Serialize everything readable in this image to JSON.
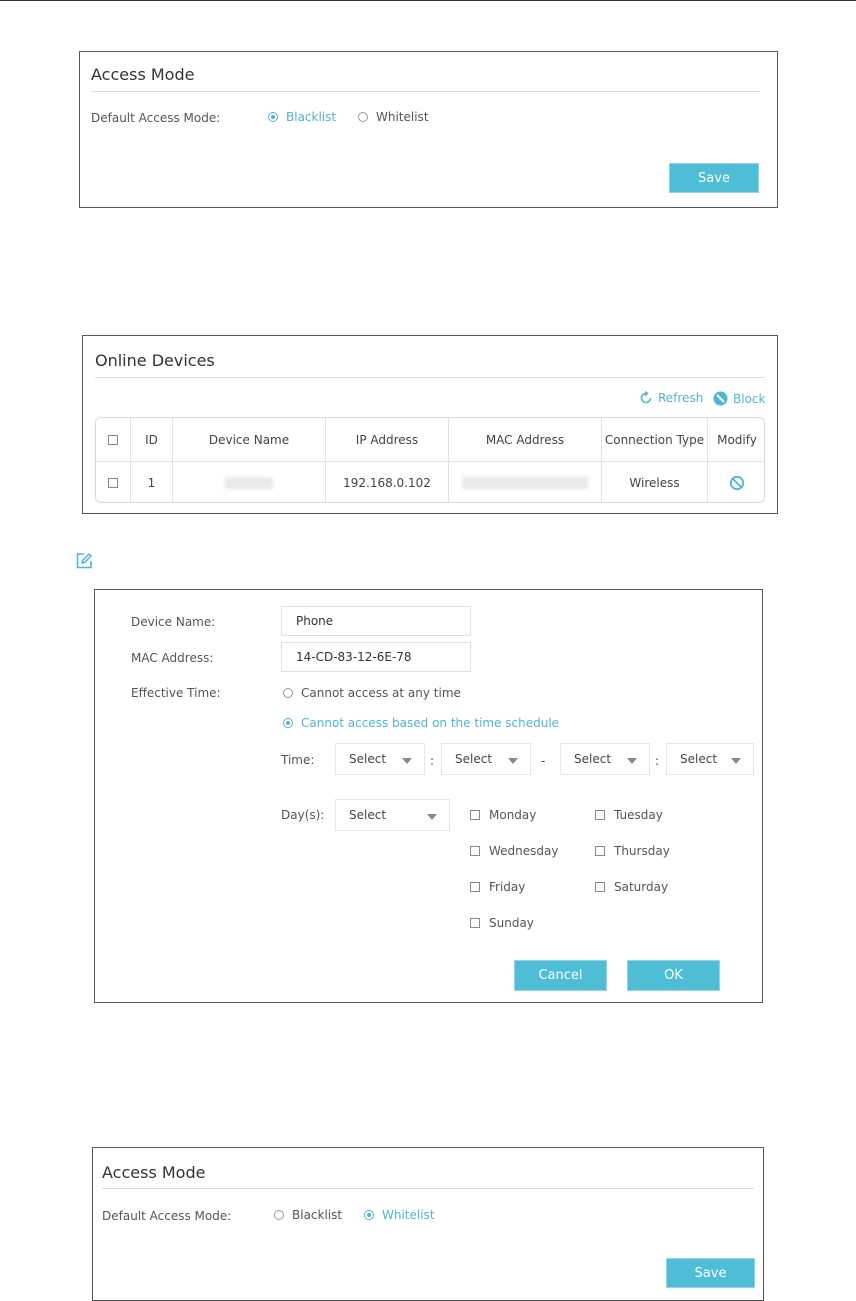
{
  "access_mode_top": {
    "title": "Access Mode",
    "default_label": "Default Access Mode:",
    "options": [
      {
        "label": "Blacklist",
        "selected": true
      },
      {
        "label": "Whitelist",
        "selected": false
      }
    ],
    "save_label": "Save"
  },
  "online_devices": {
    "title": "Online Devices",
    "refresh_label": "Refresh",
    "block_label": "Block",
    "columns": [
      "ID",
      "Device Name",
      "IP Address",
      "MAC Address",
      "Connection Type",
      "Modify"
    ],
    "rows": [
      {
        "id": "1",
        "device_name": "",
        "ip": "192.168.0.102",
        "mac": "",
        "connection_type": "Wireless"
      }
    ]
  },
  "edit_form": {
    "device_name_label": "Device Name:",
    "device_name_value": "Phone",
    "mac_label": "MAC Address:",
    "mac_value": "14-CD-83-12-6E-78",
    "effective_time_label": "Effective Time:",
    "options": [
      {
        "label": "Cannot access at any time",
        "selected": false
      },
      {
        "label": "Cannot access based on the time schedule",
        "selected": true
      }
    ],
    "time_label": "Time:",
    "time_selects": [
      "Select",
      "Select",
      "Select",
      "Select"
    ],
    "time_separators": [
      ":",
      "-",
      ":"
    ],
    "days_label": "Day(s):",
    "days_select": "Select",
    "days": [
      "Monday",
      "Tuesday",
      "Wednesday",
      "Thursday",
      "Friday",
      "Saturday",
      "Sunday"
    ],
    "cancel_label": "Cancel",
    "ok_label": "OK"
  },
  "access_mode_bottom": {
    "title": "Access Mode",
    "default_label": "Default Access Mode:",
    "options": [
      {
        "label": "Blacklist",
        "selected": false
      },
      {
        "label": "Whitelist",
        "selected": true
      }
    ],
    "save_label": "Save"
  },
  "colors": {
    "accent": "#4fb5d1",
    "button": "#4fbdd6",
    "border": "#555555"
  }
}
